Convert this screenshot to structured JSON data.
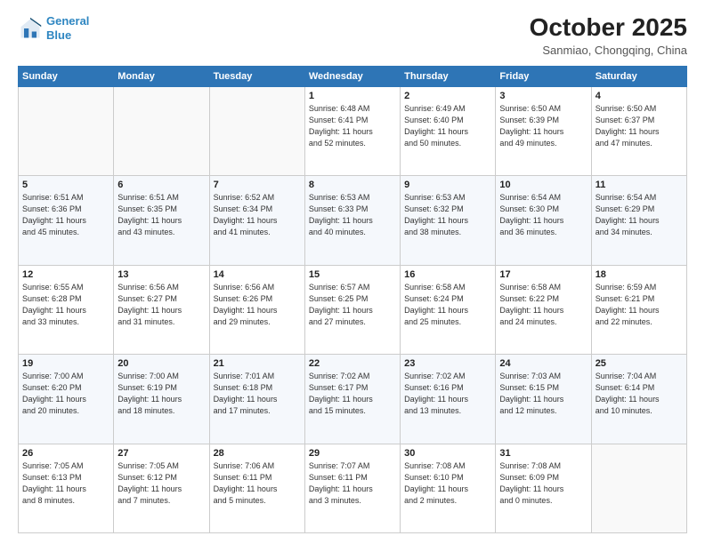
{
  "header": {
    "logo_line1": "General",
    "logo_line2": "Blue",
    "month": "October 2025",
    "location": "Sanmiao, Chongqing, China"
  },
  "weekdays": [
    "Sunday",
    "Monday",
    "Tuesday",
    "Wednesday",
    "Thursday",
    "Friday",
    "Saturday"
  ],
  "weeks": [
    [
      {
        "day": "",
        "info": ""
      },
      {
        "day": "",
        "info": ""
      },
      {
        "day": "",
        "info": ""
      },
      {
        "day": "1",
        "info": "Sunrise: 6:48 AM\nSunset: 6:41 PM\nDaylight: 11 hours\nand 52 minutes."
      },
      {
        "day": "2",
        "info": "Sunrise: 6:49 AM\nSunset: 6:40 PM\nDaylight: 11 hours\nand 50 minutes."
      },
      {
        "day": "3",
        "info": "Sunrise: 6:50 AM\nSunset: 6:39 PM\nDaylight: 11 hours\nand 49 minutes."
      },
      {
        "day": "4",
        "info": "Sunrise: 6:50 AM\nSunset: 6:37 PM\nDaylight: 11 hours\nand 47 minutes."
      }
    ],
    [
      {
        "day": "5",
        "info": "Sunrise: 6:51 AM\nSunset: 6:36 PM\nDaylight: 11 hours\nand 45 minutes."
      },
      {
        "day": "6",
        "info": "Sunrise: 6:51 AM\nSunset: 6:35 PM\nDaylight: 11 hours\nand 43 minutes."
      },
      {
        "day": "7",
        "info": "Sunrise: 6:52 AM\nSunset: 6:34 PM\nDaylight: 11 hours\nand 41 minutes."
      },
      {
        "day": "8",
        "info": "Sunrise: 6:53 AM\nSunset: 6:33 PM\nDaylight: 11 hours\nand 40 minutes."
      },
      {
        "day": "9",
        "info": "Sunrise: 6:53 AM\nSunset: 6:32 PM\nDaylight: 11 hours\nand 38 minutes."
      },
      {
        "day": "10",
        "info": "Sunrise: 6:54 AM\nSunset: 6:30 PM\nDaylight: 11 hours\nand 36 minutes."
      },
      {
        "day": "11",
        "info": "Sunrise: 6:54 AM\nSunset: 6:29 PM\nDaylight: 11 hours\nand 34 minutes."
      }
    ],
    [
      {
        "day": "12",
        "info": "Sunrise: 6:55 AM\nSunset: 6:28 PM\nDaylight: 11 hours\nand 33 minutes."
      },
      {
        "day": "13",
        "info": "Sunrise: 6:56 AM\nSunset: 6:27 PM\nDaylight: 11 hours\nand 31 minutes."
      },
      {
        "day": "14",
        "info": "Sunrise: 6:56 AM\nSunset: 6:26 PM\nDaylight: 11 hours\nand 29 minutes."
      },
      {
        "day": "15",
        "info": "Sunrise: 6:57 AM\nSunset: 6:25 PM\nDaylight: 11 hours\nand 27 minutes."
      },
      {
        "day": "16",
        "info": "Sunrise: 6:58 AM\nSunset: 6:24 PM\nDaylight: 11 hours\nand 25 minutes."
      },
      {
        "day": "17",
        "info": "Sunrise: 6:58 AM\nSunset: 6:22 PM\nDaylight: 11 hours\nand 24 minutes."
      },
      {
        "day": "18",
        "info": "Sunrise: 6:59 AM\nSunset: 6:21 PM\nDaylight: 11 hours\nand 22 minutes."
      }
    ],
    [
      {
        "day": "19",
        "info": "Sunrise: 7:00 AM\nSunset: 6:20 PM\nDaylight: 11 hours\nand 20 minutes."
      },
      {
        "day": "20",
        "info": "Sunrise: 7:00 AM\nSunset: 6:19 PM\nDaylight: 11 hours\nand 18 minutes."
      },
      {
        "day": "21",
        "info": "Sunrise: 7:01 AM\nSunset: 6:18 PM\nDaylight: 11 hours\nand 17 minutes."
      },
      {
        "day": "22",
        "info": "Sunrise: 7:02 AM\nSunset: 6:17 PM\nDaylight: 11 hours\nand 15 minutes."
      },
      {
        "day": "23",
        "info": "Sunrise: 7:02 AM\nSunset: 6:16 PM\nDaylight: 11 hours\nand 13 minutes."
      },
      {
        "day": "24",
        "info": "Sunrise: 7:03 AM\nSunset: 6:15 PM\nDaylight: 11 hours\nand 12 minutes."
      },
      {
        "day": "25",
        "info": "Sunrise: 7:04 AM\nSunset: 6:14 PM\nDaylight: 11 hours\nand 10 minutes."
      }
    ],
    [
      {
        "day": "26",
        "info": "Sunrise: 7:05 AM\nSunset: 6:13 PM\nDaylight: 11 hours\nand 8 minutes."
      },
      {
        "day": "27",
        "info": "Sunrise: 7:05 AM\nSunset: 6:12 PM\nDaylight: 11 hours\nand 7 minutes."
      },
      {
        "day": "28",
        "info": "Sunrise: 7:06 AM\nSunset: 6:11 PM\nDaylight: 11 hours\nand 5 minutes."
      },
      {
        "day": "29",
        "info": "Sunrise: 7:07 AM\nSunset: 6:11 PM\nDaylight: 11 hours\nand 3 minutes."
      },
      {
        "day": "30",
        "info": "Sunrise: 7:08 AM\nSunset: 6:10 PM\nDaylight: 11 hours\nand 2 minutes."
      },
      {
        "day": "31",
        "info": "Sunrise: 7:08 AM\nSunset: 6:09 PM\nDaylight: 11 hours\nand 0 minutes."
      },
      {
        "day": "",
        "info": ""
      }
    ]
  ]
}
